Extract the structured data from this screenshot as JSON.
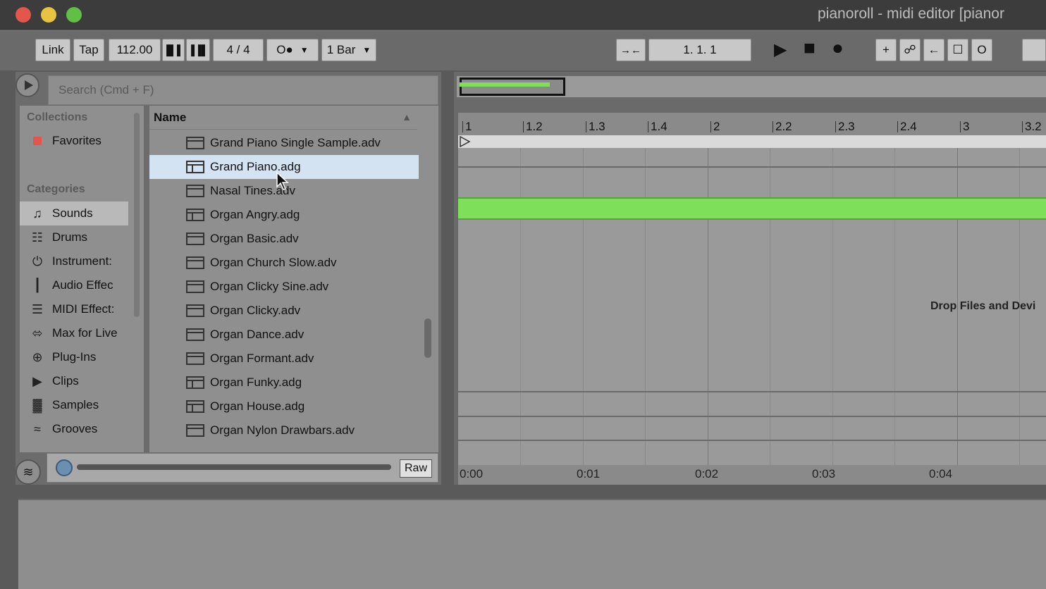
{
  "window": {
    "title": "pianoroll - midi editor  [pianor",
    "traffic_lights": {
      "close": "#e2564c",
      "minimize": "#e8c340",
      "zoom": "#5fc045"
    }
  },
  "controlbar": {
    "link": "Link",
    "tap": "Tap",
    "tempo": "112.00",
    "nudge_down": "▐▌▌",
    "nudge_up": "▐▐▌",
    "time_signature": "4  /  4",
    "metronome": "O●",
    "quantize": "1 Bar",
    "follow": "→←",
    "position": "1.   1.   1",
    "play_icon": "▶",
    "stop_icon": "■",
    "record_icon": "●",
    "add_icon": "+",
    "automation_icon": "☍",
    "back_icon": "←",
    "punch_icon": "☐",
    "loop_icon": "O"
  },
  "browser": {
    "search_placeholder": "Search (Cmd + F)",
    "collections_heading": "Collections",
    "favorites_label": "Favorites",
    "favorites_color": "#e2564c",
    "categories_heading": "Categories",
    "categories": [
      {
        "label": "Sounds",
        "icon": "♫"
      },
      {
        "label": "Drums",
        "icon": "☷"
      },
      {
        "label": "Instrument:",
        "icon": "⏻"
      },
      {
        "label": "Audio Effec",
        "icon": "┃"
      },
      {
        "label": "MIDI Effect:",
        "icon": "☰"
      },
      {
        "label": "Max for Live",
        "icon": "⬄"
      },
      {
        "label": "Plug-Ins",
        "icon": "⊕"
      },
      {
        "label": "Clips",
        "icon": "▶"
      },
      {
        "label": "Samples",
        "icon": "▓"
      },
      {
        "label": "Grooves",
        "icon": "≈"
      }
    ],
    "name_header": "Name",
    "files": [
      "Grand Piano Single Sample.adv",
      "Grand Piano.adg",
      "Nasal Tines.adv",
      "Organ Angry.adg",
      "Organ Basic.adv",
      "Organ Church Slow.adv",
      "Organ Clicky Sine.adv",
      "Organ Clicky.adv",
      "Organ Dance.adv",
      "Organ Formant.adv",
      "Organ Funky.adg",
      "Organ House.adg",
      "Organ Nylon Drawbars.adv"
    ],
    "raw_label": "Raw"
  },
  "editor": {
    "bar_ticks": [
      "1",
      "1.2",
      "1.3",
      "1.4",
      "2",
      "2.2",
      "2.3",
      "2.4",
      "3",
      "3.2"
    ],
    "time_ticks": [
      "0:00",
      "0:01",
      "0:02",
      "0:03",
      "0:04"
    ],
    "drop_hint": "Drop Files and Devi",
    "note_color": "#7ee05a"
  }
}
